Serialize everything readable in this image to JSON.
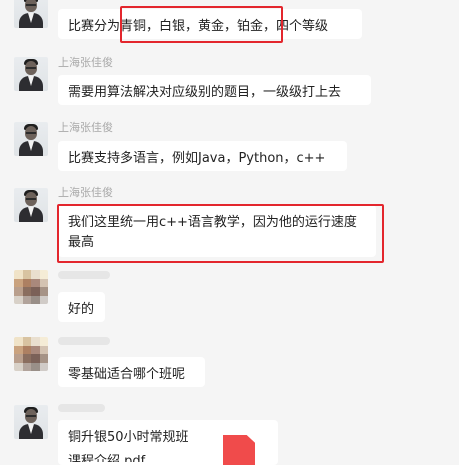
{
  "chat": {
    "messages": [
      {
        "sender": "",
        "text": "比赛分为青铜，白银，黄金，铂金，四个等级"
      },
      {
        "sender": "上海张佳俊",
        "text": "需要用算法解决对应级别的题目，一级级打上去"
      },
      {
        "sender": "上海张佳俊",
        "text": "比赛支持多语言，例如Java，Python，c++"
      },
      {
        "sender": "上海张佳俊",
        "text": "我们这里统一用c++语言教学，因为他的运行速度最高"
      },
      {
        "sender": "",
        "text": "好的"
      },
      {
        "sender": "",
        "text": "零基础适合哪个班呢"
      },
      {
        "sender": "",
        "text": "铜升银50小时常规班"
      },
      {
        "sender": "",
        "text": "课程介绍.pdf"
      }
    ]
  },
  "colors": {
    "background": "#f5f5f5",
    "bubble": "#ffffff",
    "highlight": "#e3262d",
    "sender": "#a9a9a9",
    "file": "#f04b4b"
  },
  "icons": {
    "avatar_photo": "person-photo-avatar",
    "avatar_pixel": "pixelated-avatar",
    "file": "pdf-file-icon"
  }
}
